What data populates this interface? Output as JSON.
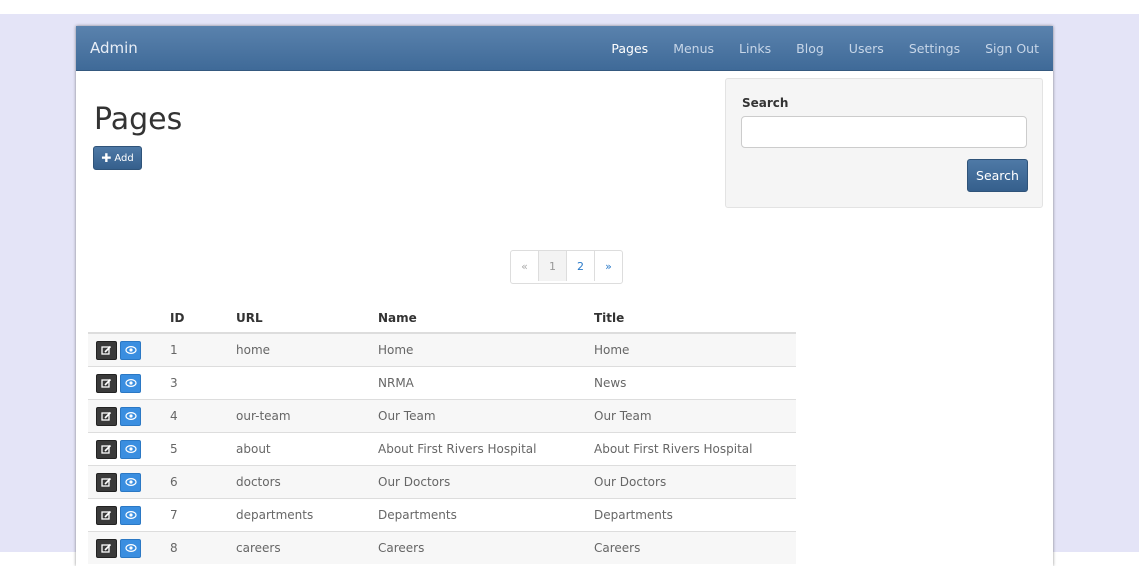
{
  "navbar": {
    "brand": "Admin",
    "items": [
      {
        "label": "Pages",
        "active": true
      },
      {
        "label": "Menus"
      },
      {
        "label": "Links"
      },
      {
        "label": "Blog"
      },
      {
        "label": "Users"
      },
      {
        "label": "Settings"
      },
      {
        "label": "Sign Out"
      }
    ]
  },
  "page": {
    "title": "Pages",
    "add_label": "Add"
  },
  "search": {
    "label": "Search",
    "value": "",
    "button_label": "Search"
  },
  "pagination": [
    "«",
    "1",
    "2",
    "»"
  ],
  "table": {
    "headers": [
      "",
      "ID",
      "URL",
      "Name",
      "Title"
    ],
    "rows": [
      {
        "id": "1",
        "url": "home",
        "name": "Home",
        "title": "Home"
      },
      {
        "id": "3",
        "url": "",
        "name": "NRMA",
        "title": "News"
      },
      {
        "id": "4",
        "url": "our-team",
        "name": "Our Team",
        "title": "Our Team"
      },
      {
        "id": "5",
        "url": "about",
        "name": "About First Rivers Hospital",
        "title": "About First Rivers Hospital"
      },
      {
        "id": "6",
        "url": "doctors",
        "name": "Our Doctors",
        "title": "Our Doctors"
      },
      {
        "id": "7",
        "url": "departments",
        "name": "Departments",
        "title": "Departments"
      },
      {
        "id": "8",
        "url": "careers",
        "name": "Careers",
        "title": "Careers"
      }
    ]
  },
  "icons": {
    "edit": "edit-icon",
    "view": "eye-icon",
    "add": "plus-icon"
  },
  "colors": {
    "navbar": "#4a75a3",
    "primary_button": "#3f6a98",
    "view_button": "#3a8ee0",
    "edit_button": "#3a3a3a"
  }
}
